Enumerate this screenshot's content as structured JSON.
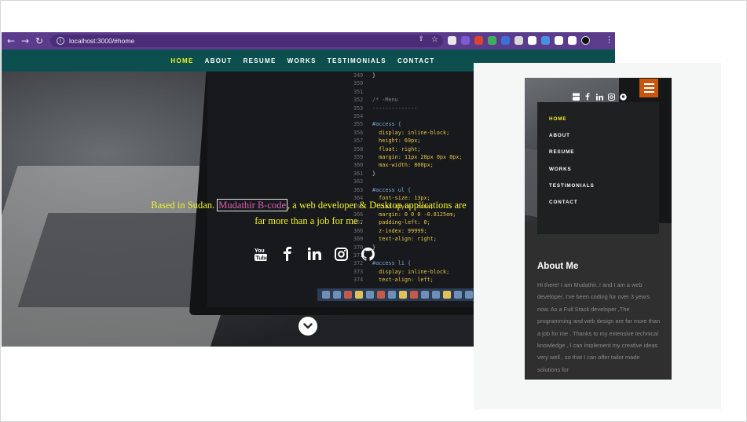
{
  "browser": {
    "url": "localhost:3000/#home",
    "nav_back": "←",
    "nav_forward": "→",
    "nav_reload": "↻",
    "info_glyph": "i",
    "star_glyph": "☆",
    "share_glyph": "⇪",
    "menu_glyph": "⋮",
    "extensions": [
      "ext-1-icon",
      "ext-2-icon",
      "ext-3-icon",
      "ext-4-icon",
      "ext-5-icon",
      "ext-6-icon",
      "ext-7-icon",
      "ext-8-icon",
      "ext-9-icon",
      "ext-10-icon",
      "ext-11-icon"
    ]
  },
  "nav": {
    "items": [
      "HOME",
      "ABOUT",
      "RESUME",
      "WORKS",
      "TESTIMONIALS",
      "CONTACT"
    ],
    "active": "HOME"
  },
  "hero": {
    "tagline_prefix": "Based in Sudan. ",
    "tagline_name": "Mudathir B-code",
    "tagline_rest": ", a web developer & Desktop applications are far more than a job for me .",
    "social": [
      "youtube-icon",
      "facebook-icon",
      "linkedin-icon",
      "instagram-icon",
      "github-icon"
    ]
  },
  "code_lines": [
    {
      "n": "349",
      "t": "}",
      "c": "prop"
    },
    {
      "n": "350",
      "t": "",
      "c": "prop"
    },
    {
      "n": "351",
      "t": "",
      "c": "prop"
    },
    {
      "n": "352",
      "t": "/* -Menu",
      "c": "cm"
    },
    {
      "n": "353",
      "t": "--------------",
      "c": "cm"
    },
    {
      "n": "354",
      "t": "",
      "c": "prop"
    },
    {
      "n": "355",
      "t": "#access {",
      "c": "sel"
    },
    {
      "n": "356",
      "t": "  display: inline-block;",
      "c": "val"
    },
    {
      "n": "357",
      "t": "  height: 69px;",
      "c": "val"
    },
    {
      "n": "358",
      "t": "  float: right;",
      "c": "val"
    },
    {
      "n": "359",
      "t": "  margin: 11px 28px 0px 0px;",
      "c": "val"
    },
    {
      "n": "360",
      "t": "  max-width: 800px;",
      "c": "val"
    },
    {
      "n": "361",
      "t": "}",
      "c": "prop"
    },
    {
      "n": "362",
      "t": "",
      "c": "prop"
    },
    {
      "n": "363",
      "t": "#access ul {",
      "c": "sel"
    },
    {
      "n": "364",
      "t": "  font-size: 13px;",
      "c": "val"
    },
    {
      "n": "365",
      "t": "  list-style: none;",
      "c": "val"
    },
    {
      "n": "366",
      "t": "  margin: 0 0 0 -0.8125em;",
      "c": "val"
    },
    {
      "n": "367",
      "t": "  padding-left: 0;",
      "c": "val"
    },
    {
      "n": "368",
      "t": "  z-index: 99999;",
      "c": "val"
    },
    {
      "n": "369",
      "t": "  text-align: right;",
      "c": "val"
    },
    {
      "n": "370",
      "t": "}",
      "c": "prop"
    },
    {
      "n": "371",
      "t": "",
      "c": "prop"
    },
    {
      "n": "372",
      "t": "#access li {",
      "c": "sel"
    },
    {
      "n": "373",
      "t": "  display: inline-block;",
      "c": "val"
    },
    {
      "n": "374",
      "t": "  text-align: left;",
      "c": "val"
    }
  ],
  "mobile": {
    "menu_items": [
      "HOME",
      "ABOUT",
      "RESUME",
      "WORKS",
      "TESTIMONIALS",
      "CONTACT"
    ],
    "active": "HOME",
    "about_title": "About Me",
    "about_text": "Hi there! I am Mudathir..! and I am a web developer. I've been coding for over 3 years now. As a Full Stack developer ,The programming and web design are far more than a job for me . Thanks to my extensive technical knowledge , I can implement my creative ideas very well , so that I can offer tailor made solutions for",
    "social": [
      "youtube-icon",
      "facebook-icon",
      "linkedin-icon",
      "instagram-icon",
      "github-icon"
    ]
  },
  "colors": {
    "browser_bar": "#5b3b8c",
    "site_nav": "#0d4f4f",
    "accent_yellow": "#f2f226",
    "name_pink": "#e05fb5",
    "hamburger": "#c9560e"
  }
}
